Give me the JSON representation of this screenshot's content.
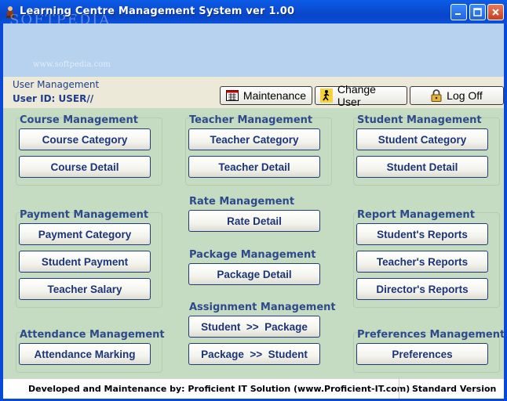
{
  "window": {
    "title": "Learning Centre Management System ver 1.00",
    "watermark": "SOFTPEDIA",
    "watermark_url": "www.softpedia.com"
  },
  "user": {
    "section_label": "User Management",
    "user_id_label": "User ID: USER//"
  },
  "toolbar": {
    "maintenance": "Maintenance",
    "change_user": "Change User",
    "log_off": "Log Off"
  },
  "sections": {
    "course": {
      "title": "Course Management",
      "buttons": [
        "Course Category",
        "Course Detail"
      ]
    },
    "teacher": {
      "title": "Teacher Management",
      "buttons": [
        "Teacher Category",
        "Teacher Detail"
      ]
    },
    "student": {
      "title": "Student Management",
      "buttons": [
        "Student Category",
        "Student Detail"
      ]
    },
    "payment": {
      "title": "Payment Management",
      "buttons": [
        "Payment Category",
        "Student Payment",
        "Teacher Salary"
      ]
    },
    "rate": {
      "title": "Rate Management",
      "buttons": [
        "Rate Detail"
      ]
    },
    "report": {
      "title": "Report Management",
      "buttons": [
        "Student's Reports",
        "Teacher's Reports",
        "Director's Reports"
      ]
    },
    "package": {
      "title": "Package Management",
      "buttons": [
        "Package Detail"
      ]
    },
    "assignment": {
      "title": "Assignment Management",
      "buttons": [
        "Student  >>  Package",
        "Package  >>  Student"
      ]
    },
    "attendance": {
      "title": "Attendance Management",
      "buttons": [
        "Attendance Marking"
      ]
    },
    "preferences": {
      "title": "Preferences Management",
      "buttons": [
        "Preferences"
      ]
    }
  },
  "footer": {
    "developer": "Developed and Maintenance by: Proficient IT Solution  (www.Proficient-IT.com)",
    "version": "Standard Version"
  },
  "colors": {
    "title_bar": "#0a4fd8",
    "banner": "#b7d2ef",
    "panel": "#c5dcc3",
    "section_title": "#2e4a8a",
    "button_text": "#1c3478"
  }
}
